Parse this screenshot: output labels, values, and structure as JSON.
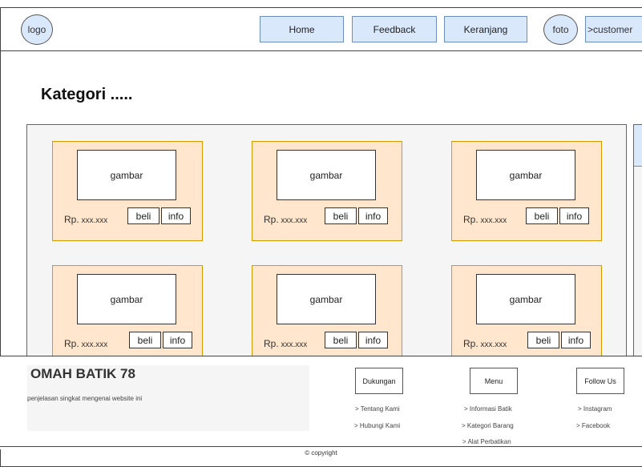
{
  "header": {
    "logo": "logo",
    "nav": [
      "Home",
      "Feedback",
      "Keranjang"
    ],
    "profile_photo": "foto",
    "customer": ">customer"
  },
  "page_title": "Kategori .....",
  "products": [
    {
      "image": "gambar",
      "price_prefix": "Rp.",
      "price": "xxx.xxx",
      "buy": "beli",
      "info": "info"
    },
    {
      "image": "gambar",
      "price_prefix": "Rp.",
      "price": "xxx.xxx",
      "buy": "beli",
      "info": "info"
    },
    {
      "image": "gambar",
      "price_prefix": "Rp.",
      "price": "xxx.xxx",
      "buy": "beli",
      "info": "info"
    },
    {
      "image": "gambar",
      "price_prefix": "Rp.",
      "price": "xxx.xxx",
      "buy": "beli",
      "info": "info"
    },
    {
      "image": "gambar",
      "price_prefix": "Rp.",
      "price": "xxx.xxx",
      "buy": "beli",
      "info": "info"
    },
    {
      "image": "gambar",
      "price_prefix": "Rp.",
      "price": "xxx.xxx",
      "buy": "beli",
      "info": "info"
    }
  ],
  "footer": {
    "brand": "OMAH BATIK 78",
    "description": "penjelasan singkat mengenai website ini",
    "sections": [
      {
        "title": "Dukungan",
        "links": [
          "> Tentang Kami",
          "> Hubungi Kami"
        ]
      },
      {
        "title": "Menu",
        "links": [
          "> Informasi Batik",
          "> Kategori Barang",
          "> Alat Perbatikan"
        ]
      },
      {
        "title": "Follow Us",
        "links": [
          "> Instagram",
          "> Facebook"
        ]
      }
    ],
    "copyright": "© copyright"
  },
  "colors": {
    "nav_fill": "#dae8fc",
    "nav_border": "#6c8ebf",
    "card_fill": "#ffe6cc",
    "card_border": "#d79b00",
    "panel_fill": "#f5f5f5"
  }
}
